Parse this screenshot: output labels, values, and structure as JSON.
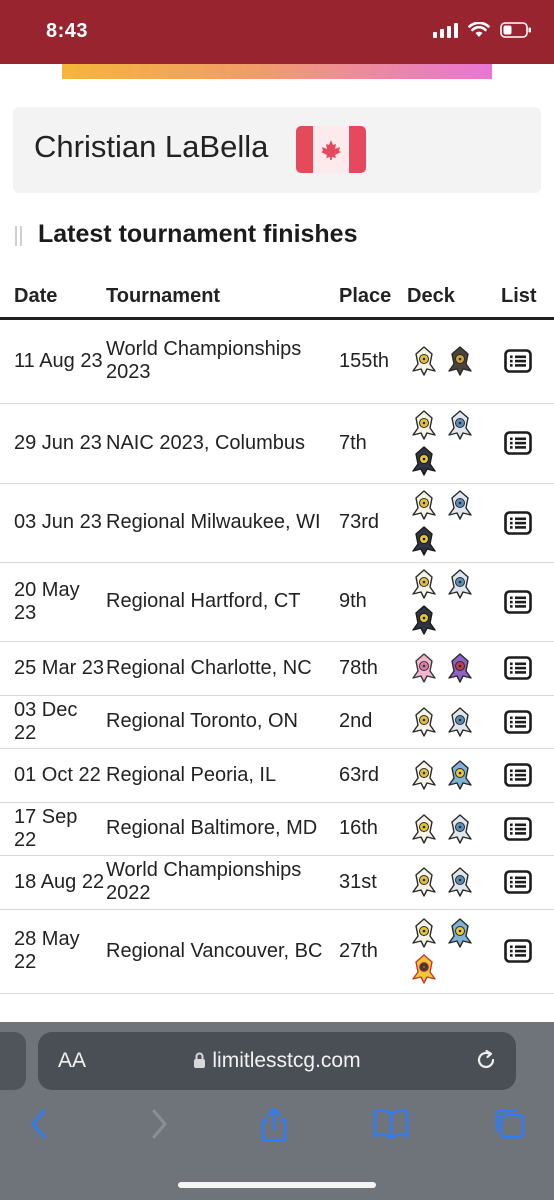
{
  "status_bar": {
    "time": "8:43"
  },
  "player": {
    "name": "Christian LaBella"
  },
  "section": {
    "title": "Latest tournament finishes"
  },
  "table": {
    "headers": {
      "date": "Date",
      "tournament": "Tournament",
      "place": "Place",
      "deck": "Deck",
      "list": "List"
    },
    "rows": [
      {
        "date": "11 Aug 23",
        "tournament": "World Championships 2023",
        "place": "155th"
      },
      {
        "date": "29 Jun 23",
        "tournament": "NAIC 2023, Columbus",
        "place": "7th"
      },
      {
        "date": "03 Jun 23",
        "tournament": "Regional Milwaukee, WI",
        "place": "73rd"
      },
      {
        "date": "20 May 23",
        "tournament": "Regional Hartford, CT",
        "place": "9th"
      },
      {
        "date": "25 Mar 23",
        "tournament": "Regional Charlotte, NC",
        "place": "78th"
      },
      {
        "date": "03 Dec 22",
        "tournament": "Regional Toronto, ON",
        "place": "2nd"
      },
      {
        "date": "01 Oct 22",
        "tournament": "Regional Peoria, IL",
        "place": "63rd"
      },
      {
        "date": "17 Sep 22",
        "tournament": "Regional Baltimore, MD",
        "place": "16th"
      },
      {
        "date": "18 Aug 22",
        "tournament": "World Championships 2022",
        "place": "31st"
      },
      {
        "date": "28 May 22",
        "tournament": "Regional Vancouver, BC",
        "place": "27th"
      }
    ]
  },
  "browser": {
    "aa_label": "AA",
    "url": "limitlesstcg.com"
  },
  "colors": {
    "status_bar": "#97242f",
    "flag_red": "#e4495c",
    "chrome": "#6f747b",
    "toolbar_icon": "#2f7bf5"
  }
}
